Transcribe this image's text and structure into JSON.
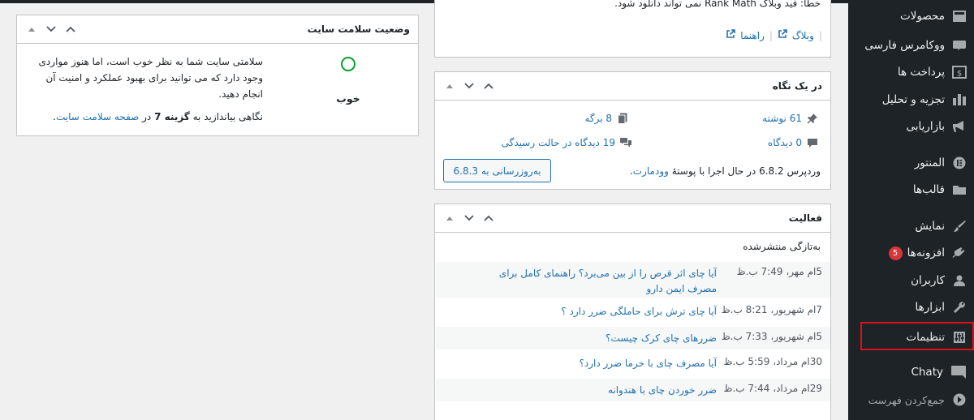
{
  "sidebar": {
    "items": [
      {
        "label": "محصولات",
        "icon": "products-icon"
      },
      {
        "label": "ووکامرس فارسی",
        "icon": "woocommerce-persian-icon"
      },
      {
        "label": "پرداخت ها",
        "icon": "payments-icon"
      },
      {
        "label": "تجزیه و تحلیل",
        "icon": "analytics-icon"
      },
      {
        "label": "بازاریابی",
        "icon": "marketing-icon"
      },
      {
        "label": "المنتور",
        "icon": "elementor-icon"
      },
      {
        "label": "قالب‌ها",
        "icon": "templates-folder-icon"
      },
      {
        "label": "نمایش",
        "icon": "appearance-brush-icon"
      },
      {
        "label": "افزونه‌ها",
        "icon": "plugins-icon",
        "badge": "5"
      },
      {
        "label": "کاربران",
        "icon": "users-icon"
      },
      {
        "label": "ابزارها",
        "icon": "tools-wrench-icon"
      },
      {
        "label": "تنظیمات",
        "icon": "settings-icon"
      },
      {
        "label": "Chaty",
        "icon": "chaty-chat-icon"
      },
      {
        "label": "جمع‌کردن فهرست",
        "icon": "collapse-menu-icon"
      }
    ]
  },
  "health": {
    "title": "وضعیت سلامت سایت",
    "status": "خوب",
    "description": "سلامتی سایت شما به نظر خوب است، اما هنوز مواردی وجود دارد که می توانید برای بهبود عملکرد و امنیت آن انجام دهید.",
    "more_prefix": "نگاهی بیاندازید به",
    "more_count": "گزینه 7",
    "more_mid": "در",
    "more_link": "صفحه سلامت سایت",
    "more_suffix": "."
  },
  "rankmath": {
    "top_text": "خطا: فید وبلاگ Rank Math نمی تواند دانلود شود.",
    "blog_link": "وبلاگ",
    "help_link": "راهنما"
  },
  "glance": {
    "title": "در یک نگاه",
    "posts": "61 نوشته",
    "pages": "8 برگه",
    "comments": "0 دیدگاه",
    "moderation": "19 دیدگاه در حالت رسیدگی",
    "version_prefix": "وردپرس 6.8.2 در حال اجرا با پوستهٔ",
    "theme_link": "وودمارت",
    "version_suffix": ".",
    "update_button": "به‌روزرسانی به 6.8.3"
  },
  "activity": {
    "title": "فعالیت",
    "subtitle": "به‌تازگی منتشرشده",
    "rows": [
      {
        "date": "5ام مهر، 7:49 ب.ظ",
        "title": "آیا چای اثر قرص را از بین می‌برد؟ راهنمای کامل برای مصرف ایمن دارو"
      },
      {
        "date": "7ام شهریور، 8:21 ب.ظ",
        "title": "آیا چای ترش برای حاملگی ضرر دارد ؟"
      },
      {
        "date": "5ام شهریور، 7:33 ب.ظ",
        "title": "ضررهای چای کرک چیست؟"
      },
      {
        "date": "30ام مرداد، 5:59 ب.ظ",
        "title": "آیا مصرف چای با خرما ضرر دارد؟"
      },
      {
        "date": "29ام مرداد، 7:44 ب.ظ",
        "title": "ضرر خوردن چای با هندوانه"
      }
    ]
  },
  "colors": {
    "sidebar_bg": "#1d2327",
    "link": "#2271b1",
    "badge": "#d63638",
    "good": "#00a32a",
    "highlight": "#e0101a"
  }
}
